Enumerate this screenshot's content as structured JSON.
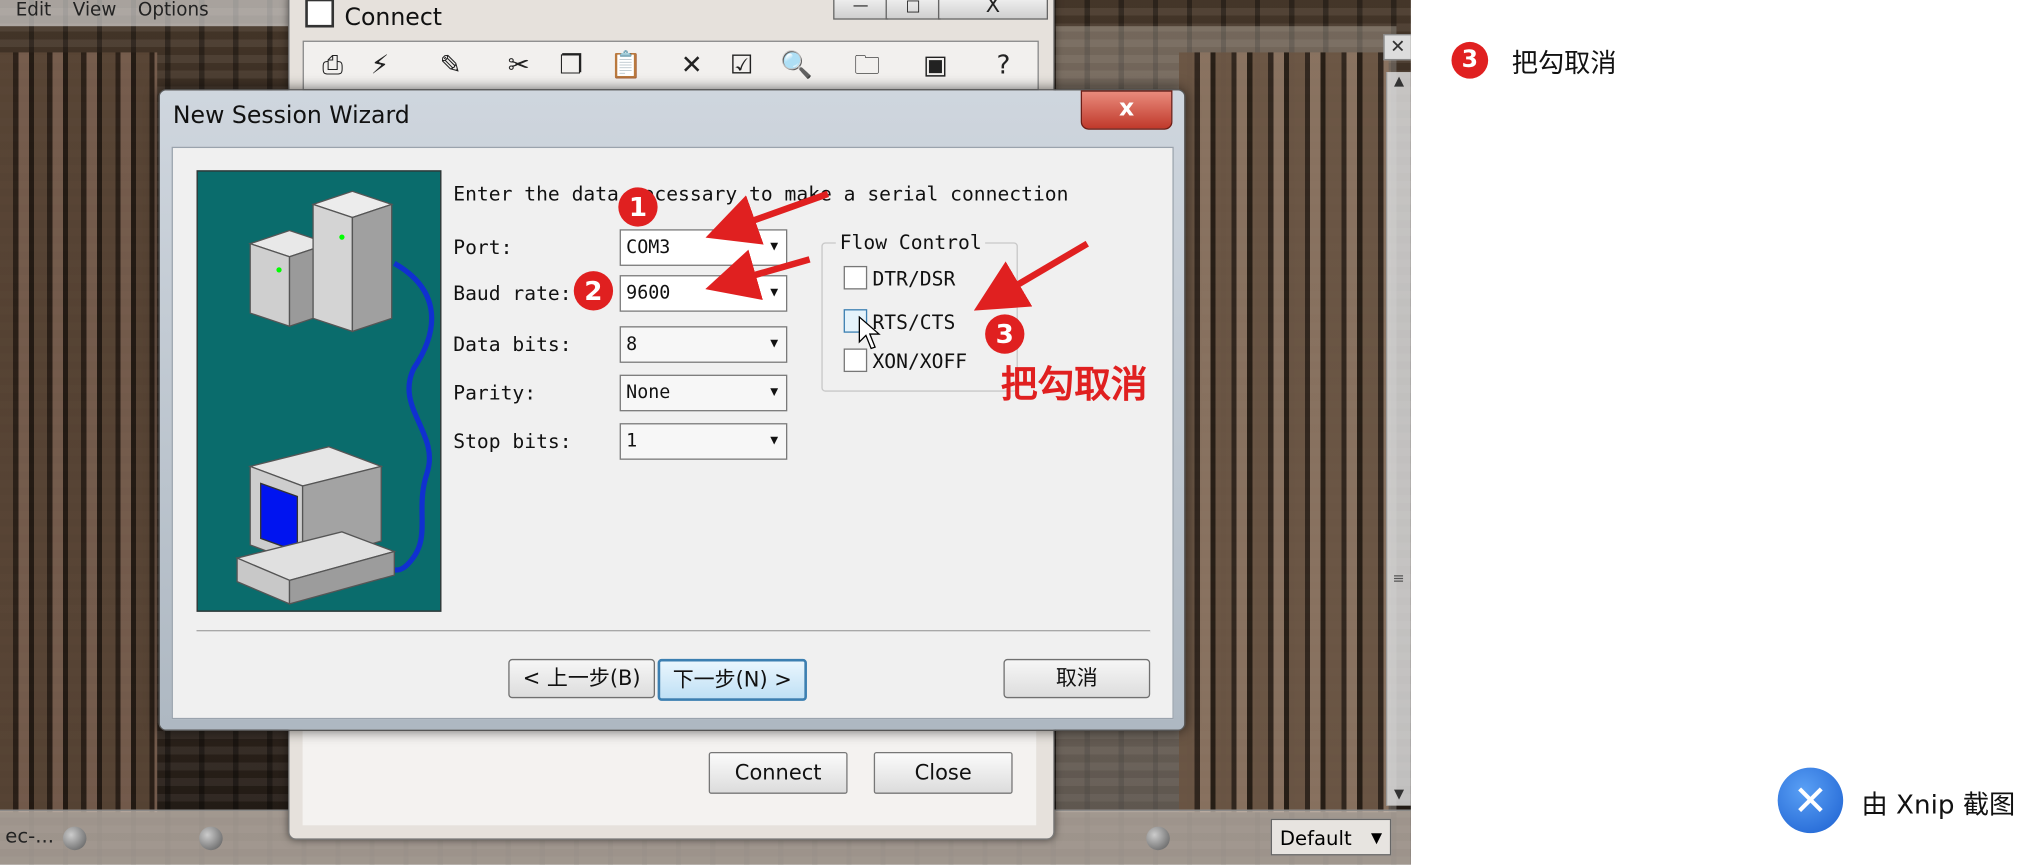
{
  "background_window": {
    "menu": [
      "Edit",
      "View",
      "Options"
    ],
    "status_left": "ec-...",
    "status_dropdown": "Default"
  },
  "connect_window": {
    "title": "Connect",
    "minimize": "—",
    "maximize": "□",
    "close": "X",
    "toolbar_icons": [
      "connect-icon",
      "quick-connect-icon",
      "new-session-icon",
      "cut-icon",
      "copy-icon",
      "paste-icon",
      "delete-icon",
      "properties-icon",
      "find-icon",
      "new-folder-icon",
      "terminal-icon",
      "help-icon"
    ],
    "connect_button": "Connect",
    "close_button": "Close"
  },
  "wizard": {
    "title": "New Session Wizard",
    "close": "x",
    "heading": "Enter the data necessary to make a serial connection",
    "port_label": "Port:",
    "port_value": "COM3",
    "baud_label": "Baud rate:",
    "baud_value": "9600",
    "databits_label": "Data bits:",
    "databits_value": "8",
    "parity_label": "Parity:",
    "parity_value": "None",
    "stopbits_label": "Stop bits:",
    "stopbits_value": "1",
    "flow_control_title": "Flow Control",
    "flow": [
      {
        "label": "DTR/DSR",
        "checked": false
      },
      {
        "label": "RTS/CTS",
        "checked": false
      },
      {
        "label": "XON/XOFF",
        "checked": false
      }
    ],
    "back_button": "< 上一步(B)",
    "next_button": "下一步(N) >",
    "cancel_button": "取消"
  },
  "annotations": {
    "badge1": "1",
    "badge2": "2",
    "badge3": "3",
    "text3": "把勾取消",
    "color": "#e02020"
  },
  "sidebar_note": {
    "badge": "3",
    "text": "把勾取消"
  },
  "watermark": {
    "text": "由 Xnip 截图"
  }
}
